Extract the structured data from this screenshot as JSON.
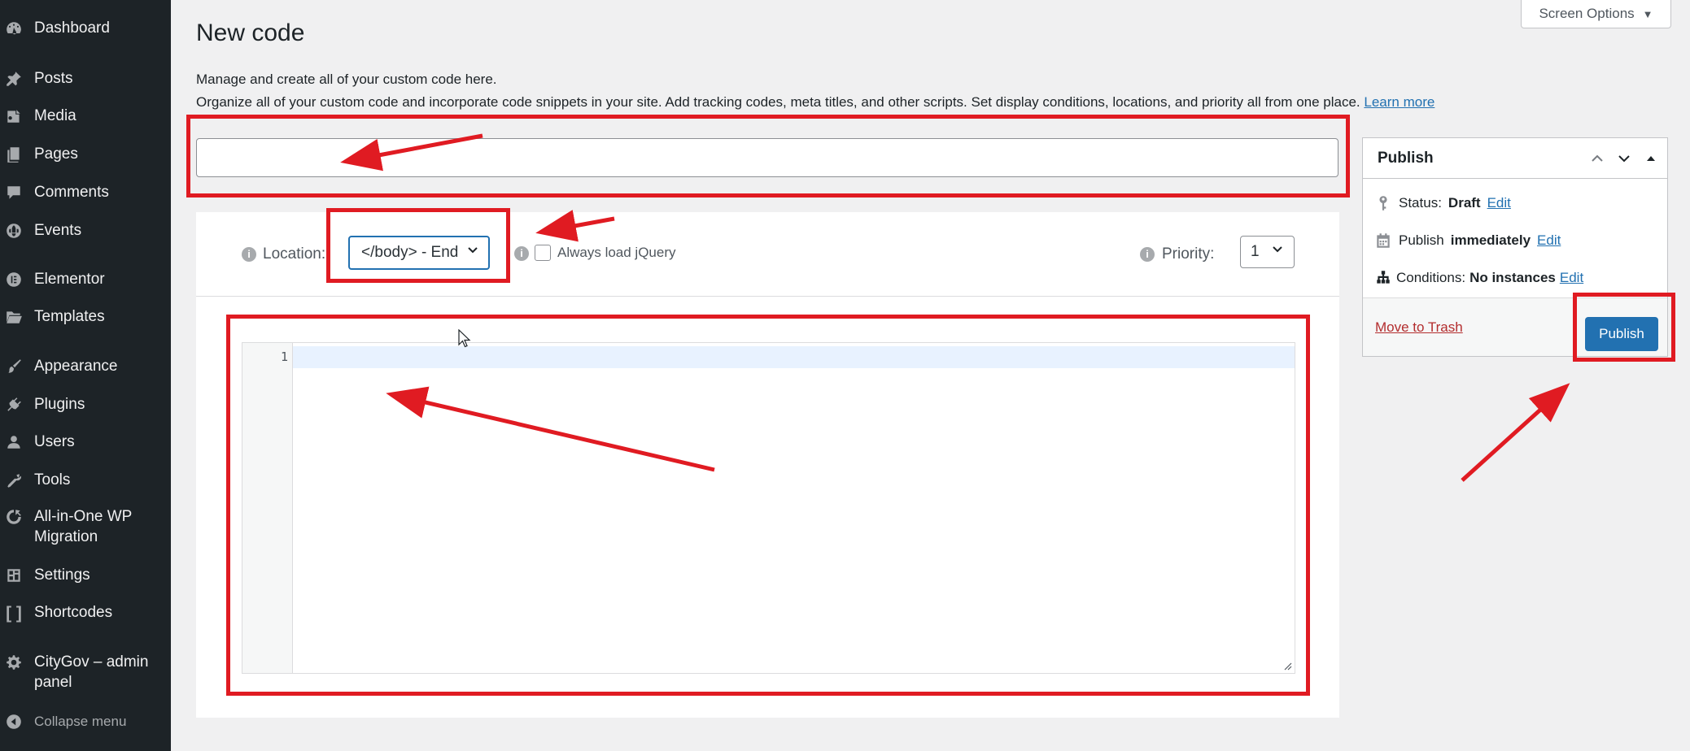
{
  "sidebar": {
    "items": [
      {
        "label": "Dashboard",
        "icon": "dashboard-icon"
      },
      {
        "label": "Posts",
        "icon": "pin-icon"
      },
      {
        "label": "Media",
        "icon": "media-icon"
      },
      {
        "label": "Pages",
        "icon": "pages-icon"
      },
      {
        "label": "Comments",
        "icon": "comment-icon"
      },
      {
        "label": "Events",
        "icon": "globe-icon"
      },
      {
        "label": "Elementor",
        "icon": "elementor-icon"
      },
      {
        "label": "Templates",
        "icon": "folder-icon"
      },
      {
        "label": "Appearance",
        "icon": "paintbrush-icon"
      },
      {
        "label": "Plugins",
        "icon": "plugin-icon"
      },
      {
        "label": "Users",
        "icon": "user-icon"
      },
      {
        "label": "Tools",
        "icon": "wrench-icon"
      },
      {
        "label": "All-in-One WP Migration",
        "icon": "migration-icon"
      },
      {
        "label": "Settings",
        "icon": "settings-icon"
      },
      {
        "label": "Shortcodes",
        "icon": "brackets-icon"
      },
      {
        "label": "CityGov – admin panel",
        "icon": "gear-icon"
      }
    ],
    "collapse_label": "Collapse menu"
  },
  "page": {
    "title": "New code",
    "screen_options": "Screen Options",
    "description_1": "Manage and create all of your custom code here.",
    "description_2": "Organize all of your custom code and incorporate code snippets in your site. Add tracking codes, meta titles, and other scripts. Set display conditions, locations, and priority all from one place.",
    "learn_more": "Learn more",
    "title_input_value": ""
  },
  "settings": {
    "location_label": "Location:",
    "location_value": "</body> - End",
    "jquery_label": "Always load jQuery",
    "jquery_checked": false,
    "priority_label": "Priority:",
    "priority_value": "1"
  },
  "editor": {
    "line_number": "1",
    "content": ""
  },
  "publish": {
    "title": "Publish",
    "status_label": "Status:",
    "status_value": "Draft",
    "publish_label": "Publish",
    "publish_value": "immediately",
    "conditions_label": "Conditions:",
    "conditions_value": "No instances",
    "edit_label": "Edit",
    "trash_label": "Move to Trash",
    "button_label": "Publish"
  },
  "colors": {
    "sidebar_bg": "#1d2327",
    "accent": "#2271b1",
    "annotation": "#e01b22",
    "trash": "#b32d2e"
  }
}
